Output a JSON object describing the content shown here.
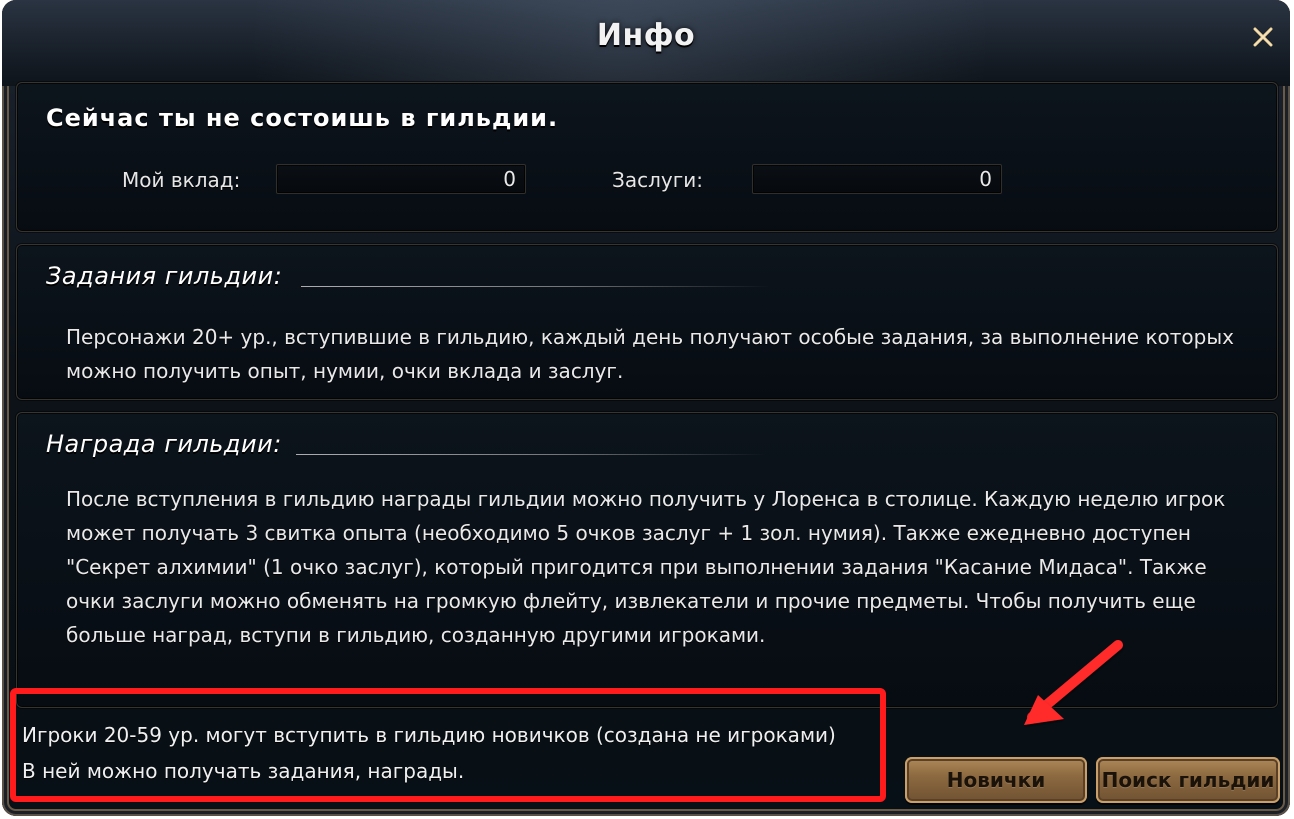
{
  "window": {
    "title": "Инфо"
  },
  "status": {
    "headline": "Сейчас ты не состоишь в гильдии.",
    "my_contribution_label": "Мой вклад:",
    "my_contribution_value": "0",
    "merits_label": "Заслуги:",
    "merits_value": "0"
  },
  "guild_tasks": {
    "heading": "Задания гильдии:",
    "text": "Персонажи 20+ ур., вступившие в гильдию, каждый день получают особые задания, за выполнение которых можно получить опыт, нумии, очки вклада и заслуг."
  },
  "guild_rewards": {
    "heading": "Награда гильдии:",
    "text": "После вступления в гильдию награды гильдии можно получить у Лоренса в столице. Каждую неделю игрок может получать 3 свитка опыта (необходимо 5 очков заслуг + 1 зол. нумия). Также ежедневно доступен \"Секрет алхимии\" (1 очко заслуг), который пригодится при выполнении задания \"Касание Мидаса\". Также очки заслуги можно обменять на громкую флейту, извлекатели и прочие предметы. Чтобы получить еще больше наград, вступи в гильдию, созданную другими игроками."
  },
  "footer": {
    "line1": "Игроки 20-59 ур. могут вступить в гильдию новичков (создана не игроками)",
    "line2": "В ней можно получать задания, награды."
  },
  "buttons": {
    "novice": "Новички",
    "search_guild": "Поиск гильдии"
  },
  "colors": {
    "annotation_red": "#ff1b1b",
    "button_gold": "#b18b5b"
  },
  "icons": {
    "close": "close-x-icon",
    "arrow": "red-arrow-annotation-icon"
  }
}
